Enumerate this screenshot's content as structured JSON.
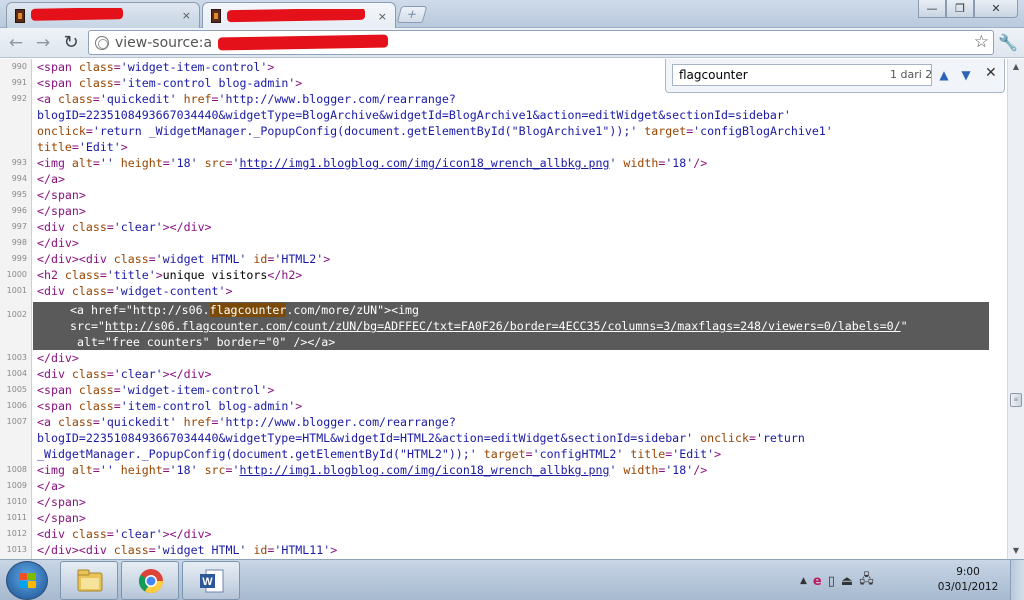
{
  "tabs": [
    {
      "title": "Bl",
      "close": "×",
      "redacted": true
    },
    {
      "title": "vie",
      "close": "×",
      "redacted": true
    }
  ],
  "new_tab_glyph": "+",
  "window_controls": {
    "minimize": "—",
    "maximize": "❐",
    "close": "✕"
  },
  "toolbar": {
    "back": "←",
    "forward": "→",
    "reload": "↻",
    "url": "view-source:a",
    "star": "☆",
    "wrench": "🔧"
  },
  "find_bar": {
    "query": "flagcounter",
    "count": "1 dari 2",
    "prev": "▲",
    "next": "▼",
    "close": "✕"
  },
  "source": {
    "lines": [
      {
        "num": "990",
        "parts": [
          [
            "tg",
            "<span "
          ],
          [
            "at",
            "class"
          ],
          [
            "tg",
            "="
          ],
          [
            "vl",
            "'widget-item-control'"
          ],
          [
            "tg",
            ">"
          ]
        ]
      },
      {
        "num": "991",
        "parts": [
          [
            "tg",
            "<span "
          ],
          [
            "at",
            "class"
          ],
          [
            "tg",
            "="
          ],
          [
            "vl",
            "'item-control blog-admin'"
          ],
          [
            "tg",
            ">"
          ]
        ]
      },
      {
        "num": "992",
        "parts": [
          [
            "tg",
            "<a "
          ],
          [
            "at",
            "class"
          ],
          [
            "tg",
            "="
          ],
          [
            "vl",
            "'quickedit' "
          ],
          [
            "at",
            "href"
          ],
          [
            "tg",
            "="
          ],
          [
            "vl",
            "'http://www.blogger.com/rearrange?"
          ]
        ]
      },
      {
        "num": "",
        "parts": [
          [
            "vl",
            "blogID=2235108493667034440&widgetType=BlogArchive&widgetId=BlogArchive1&action=editWidget&sectionId=sidebar'"
          ]
        ]
      },
      {
        "num": "",
        "parts": [
          [
            "at",
            "onclick"
          ],
          [
            "tg",
            "="
          ],
          [
            "vl",
            "'return _WidgetManager._PopupConfig(document.getElementById(\"BlogArchive1\"));' "
          ],
          [
            "at",
            "target"
          ],
          [
            "tg",
            "="
          ],
          [
            "vl",
            "'configBlogArchive1'"
          ]
        ]
      },
      {
        "num": "",
        "parts": [
          [
            "at",
            "title"
          ],
          [
            "tg",
            "="
          ],
          [
            "vl",
            "'Edit'"
          ],
          [
            "tg",
            ">"
          ]
        ]
      },
      {
        "num": "993",
        "parts": [
          [
            "tg",
            "<img "
          ],
          [
            "at",
            "alt"
          ],
          [
            "tg",
            "="
          ],
          [
            "vl",
            "'' "
          ],
          [
            "at",
            "height"
          ],
          [
            "tg",
            "="
          ],
          [
            "vl",
            "'18' "
          ],
          [
            "at",
            "src"
          ],
          [
            "tg",
            "="
          ],
          [
            "vl",
            "'"
          ],
          [
            "lk",
            "http://img1.blogblog.com/img/icon18_wrench_allbkg.png"
          ],
          [
            "vl",
            "' "
          ],
          [
            "at",
            "width"
          ],
          [
            "tg",
            "="
          ],
          [
            "vl",
            "'18'"
          ],
          [
            "tg",
            "/>"
          ]
        ]
      },
      {
        "num": "994",
        "parts": [
          [
            "tg",
            "</a>"
          ]
        ]
      },
      {
        "num": "995",
        "parts": [
          [
            "tg",
            "</span>"
          ]
        ]
      },
      {
        "num": "996",
        "parts": [
          [
            "tg",
            "</span>"
          ]
        ]
      },
      {
        "num": "997",
        "parts": [
          [
            "tg",
            "<div "
          ],
          [
            "at",
            "class"
          ],
          [
            "tg",
            "="
          ],
          [
            "vl",
            "'clear'"
          ],
          [
            "tg",
            "></div>"
          ]
        ]
      },
      {
        "num": "998",
        "parts": [
          [
            "tg",
            "</div>"
          ]
        ]
      },
      {
        "num": "999",
        "parts": [
          [
            "tg",
            "</div><div "
          ],
          [
            "at",
            "class"
          ],
          [
            "tg",
            "="
          ],
          [
            "vl",
            "'widget HTML' "
          ],
          [
            "at",
            "id"
          ],
          [
            "tg",
            "="
          ],
          [
            "vl",
            "'HTML2'"
          ],
          [
            "tg",
            ">"
          ]
        ]
      },
      {
        "num": "1000",
        "parts": [
          [
            "tg",
            "<h2 "
          ],
          [
            "at",
            "class"
          ],
          [
            "tg",
            "="
          ],
          [
            "vl",
            "'title'"
          ],
          [
            "tg",
            ">"
          ],
          [
            "tx",
            "unique visitors"
          ],
          [
            "tg",
            "</h2>"
          ]
        ]
      },
      {
        "num": "1001",
        "parts": [
          [
            "tg",
            "<div "
          ],
          [
            "at",
            "class"
          ],
          [
            "tg",
            "="
          ],
          [
            "vl",
            "'widget-content'"
          ],
          [
            "tg",
            ">"
          ]
        ]
      }
    ],
    "highlight": {
      "num": "1002",
      "line1_pre": "<a href=\"http://s06.",
      "line1_match": "flagcounter",
      "line1_post": ".com/more/zUN\"><img",
      "line2_pre": "src=\"",
      "line2_link": "http://s06.flagcounter.com/count/zUN/bg=ADFFEC/txt=FA0F26/border=4ECC35/columns=3/maxflags=248/viewers=0/labels=0/",
      "line2_post": "\"",
      "line3": " alt=\"free counters\" border=\"0\" /></a>"
    },
    "lines_after": [
      {
        "num": "1003",
        "parts": [
          [
            "tg",
            "</div>"
          ]
        ]
      },
      {
        "num": "1004",
        "parts": [
          [
            "tg",
            "<div "
          ],
          [
            "at",
            "class"
          ],
          [
            "tg",
            "="
          ],
          [
            "vl",
            "'clear'"
          ],
          [
            "tg",
            "></div>"
          ]
        ]
      },
      {
        "num": "1005",
        "parts": [
          [
            "tg",
            "<span "
          ],
          [
            "at",
            "class"
          ],
          [
            "tg",
            "="
          ],
          [
            "vl",
            "'widget-item-control'"
          ],
          [
            "tg",
            ">"
          ]
        ]
      },
      {
        "num": "1006",
        "parts": [
          [
            "tg",
            "<span "
          ],
          [
            "at",
            "class"
          ],
          [
            "tg",
            "="
          ],
          [
            "vl",
            "'item-control blog-admin'"
          ],
          [
            "tg",
            ">"
          ]
        ]
      },
      {
        "num": "1007",
        "parts": [
          [
            "tg",
            "<a "
          ],
          [
            "at",
            "class"
          ],
          [
            "tg",
            "="
          ],
          [
            "vl",
            "'quickedit' "
          ],
          [
            "at",
            "href"
          ],
          [
            "tg",
            "="
          ],
          [
            "vl",
            "'http://www.blogger.com/rearrange?"
          ]
        ]
      },
      {
        "num": "",
        "parts": [
          [
            "vl",
            "blogID=2235108493667034440&widgetType=HTML&widgetId=HTML2&action=editWidget&sectionId=sidebar' "
          ],
          [
            "at",
            "onclick"
          ],
          [
            "tg",
            "="
          ],
          [
            "vl",
            "'return"
          ]
        ]
      },
      {
        "num": "",
        "parts": [
          [
            "vl",
            "_WidgetManager._PopupConfig(document.getElementById(\"HTML2\"));' "
          ],
          [
            "at",
            "target"
          ],
          [
            "tg",
            "="
          ],
          [
            "vl",
            "'configHTML2' "
          ],
          [
            "at",
            "title"
          ],
          [
            "tg",
            "="
          ],
          [
            "vl",
            "'Edit'"
          ],
          [
            "tg",
            ">"
          ]
        ]
      },
      {
        "num": "1008",
        "parts": [
          [
            "tg",
            "<img "
          ],
          [
            "at",
            "alt"
          ],
          [
            "tg",
            "="
          ],
          [
            "vl",
            "'' "
          ],
          [
            "at",
            "height"
          ],
          [
            "tg",
            "="
          ],
          [
            "vl",
            "'18' "
          ],
          [
            "at",
            "src"
          ],
          [
            "tg",
            "="
          ],
          [
            "vl",
            "'"
          ],
          [
            "lk",
            "http://img1.blogblog.com/img/icon18_wrench_allbkg.png"
          ],
          [
            "vl",
            "' "
          ],
          [
            "at",
            "width"
          ],
          [
            "tg",
            "="
          ],
          [
            "vl",
            "'18'"
          ],
          [
            "tg",
            "/>"
          ]
        ]
      },
      {
        "num": "1009",
        "parts": [
          [
            "tg",
            "</a>"
          ]
        ]
      },
      {
        "num": "1010",
        "parts": [
          [
            "tg",
            "</span>"
          ]
        ]
      },
      {
        "num": "1011",
        "parts": [
          [
            "tg",
            "</span>"
          ]
        ]
      },
      {
        "num": "1012",
        "parts": [
          [
            "tg",
            "<div "
          ],
          [
            "at",
            "class"
          ],
          [
            "tg",
            "="
          ],
          [
            "vl",
            "'clear'"
          ],
          [
            "tg",
            "></div>"
          ]
        ]
      },
      {
        "num": "1013",
        "parts": [
          [
            "tg",
            "</div><div "
          ],
          [
            "at",
            "class"
          ],
          [
            "tg",
            "="
          ],
          [
            "vl",
            "'widget HTML' "
          ],
          [
            "at",
            "id"
          ],
          [
            "tg",
            "="
          ],
          [
            "vl",
            "'HTML11'"
          ],
          [
            "tg",
            ">"
          ]
        ]
      }
    ]
  },
  "taskbar": {
    "apps": [
      "windows-explorer",
      "google-chrome",
      "microsoft-word"
    ],
    "tray_icons": [
      "▲",
      "e",
      "▯",
      "⏏",
      "🖧"
    ],
    "time": "9:00",
    "date": "03/01/2012"
  },
  "colors": {
    "highlight_bg": "#5a5a5a",
    "match_bg": "#7a4a06",
    "tag": "#881280",
    "attr": "#994500",
    "value": "#1a1aa6"
  }
}
